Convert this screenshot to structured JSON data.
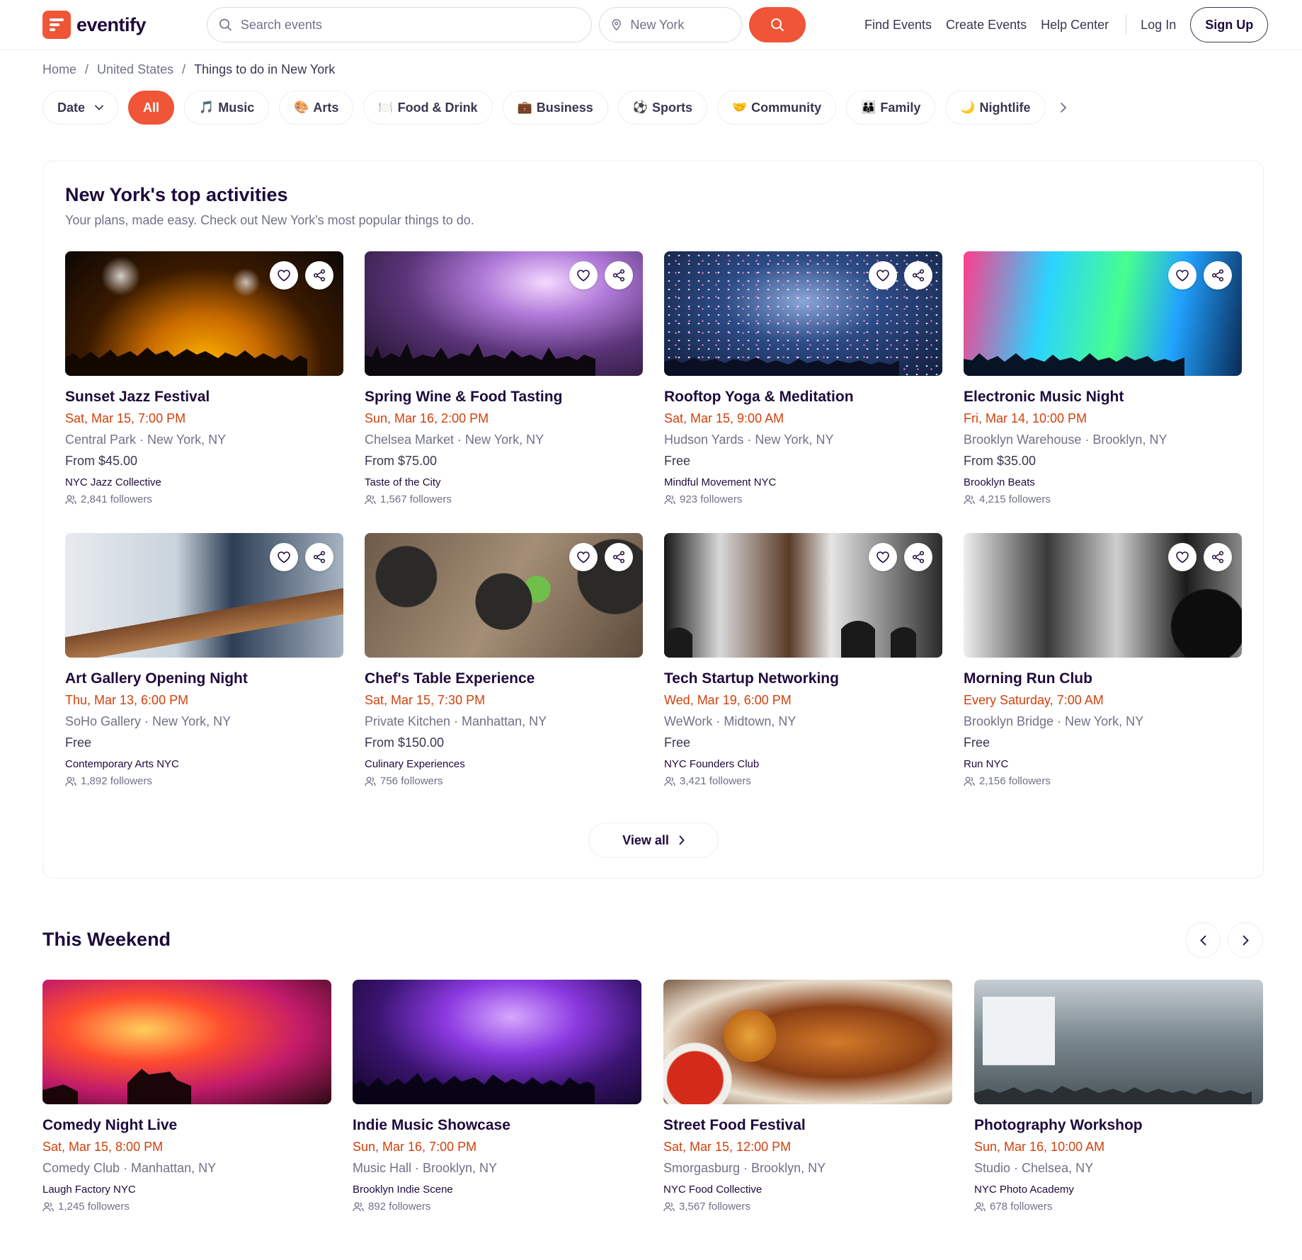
{
  "brand": {
    "name": "eventify",
    "accent": "#f05537"
  },
  "search": {
    "placeholder": "Search events",
    "location_placeholder": "New York"
  },
  "nav": {
    "find": "Find Events",
    "create": "Create Events",
    "help": "Help Center",
    "login": "Log In",
    "signup": "Sign Up"
  },
  "breadcrumb": [
    "Home",
    "United States",
    "Things to do in New York"
  ],
  "filters": {
    "date": "Date",
    "chips": [
      {
        "label": "All",
        "icon": "",
        "active": true
      },
      {
        "label": "Music",
        "icon": "🎵"
      },
      {
        "label": "Arts",
        "icon": "🎨"
      },
      {
        "label": "Food & Drink",
        "icon": "🍽️"
      },
      {
        "label": "Business",
        "icon": "💼"
      },
      {
        "label": "Sports",
        "icon": "⚽"
      },
      {
        "label": "Community",
        "icon": "🤝"
      },
      {
        "label": "Family",
        "icon": "👪"
      },
      {
        "label": "Nightlife",
        "icon": "🌙"
      }
    ]
  },
  "top": {
    "title": "New York's top activities",
    "subtitle": "Your plans, made easy. Check out New York's most popular things to do.",
    "view_all": "View all",
    "events": [
      {
        "title": "Sunset Jazz Festival",
        "date": "Sat, Mar 15, 7:00 PM",
        "location": "Central Park · New York, NY",
        "price": "From $45.00",
        "organizer": "NYC Jazz Collective",
        "followers": "2,841 followers"
      },
      {
        "title": "Spring Wine & Food Tasting",
        "date": "Sun, Mar 16, 2:00 PM",
        "location": "Chelsea Market · New York, NY",
        "price": "From $75.00",
        "organizer": "Taste of the City",
        "followers": "1,567 followers"
      },
      {
        "title": "Rooftop Yoga & Meditation",
        "date": "Sat, Mar 15, 9:00 AM",
        "location": "Hudson Yards · New York, NY",
        "price": "Free",
        "organizer": "Mindful Movement NYC",
        "followers": "923 followers"
      },
      {
        "title": "Electronic Music Night",
        "date": "Fri, Mar 14, 10:00 PM",
        "location": "Brooklyn Warehouse · Brooklyn, NY",
        "price": "From $35.00",
        "organizer": "Brooklyn Beats",
        "followers": "4,215 followers"
      },
      {
        "title": "Art Gallery Opening Night",
        "date": "Thu, Mar 13, 6:00 PM",
        "location": "SoHo Gallery · New York, NY",
        "price": "Free",
        "organizer": "Contemporary Arts NYC",
        "followers": "1,892 followers"
      },
      {
        "title": "Chef's Table Experience",
        "date": "Sat, Mar 15, 7:30 PM",
        "location": "Private Kitchen · Manhattan, NY",
        "price": "From $150.00",
        "organizer": "Culinary Experiences",
        "followers": "756 followers"
      },
      {
        "title": "Tech Startup Networking",
        "date": "Wed, Mar 19, 6:00 PM",
        "location": "WeWork · Midtown, NY",
        "price": "Free",
        "organizer": "NYC Founders Club",
        "followers": "3,421 followers"
      },
      {
        "title": "Morning Run Club",
        "date": "Every Saturday, 7:00 AM",
        "location": "Brooklyn Bridge · New York, NY",
        "price": "Free",
        "organizer": "Run NYC",
        "followers": "2,156 followers"
      }
    ]
  },
  "weekend": {
    "title": "This Weekend",
    "events": [
      {
        "title": "Comedy Night Live",
        "date": "Sat, Mar 15, 8:00 PM",
        "location": "Comedy Club · Manhattan, NY",
        "organizer": "Laugh Factory NYC",
        "followers": "1,245 followers"
      },
      {
        "title": "Indie Music Showcase",
        "date": "Sun, Mar 16, 7:00 PM",
        "location": "Music Hall · Brooklyn, NY",
        "organizer": "Brooklyn Indie Scene",
        "followers": "892 followers"
      },
      {
        "title": "Street Food Festival",
        "date": "Sat, Mar 15, 12:00 PM",
        "location": "Smorgasburg · Brooklyn, NY",
        "organizer": "NYC Food Collective",
        "followers": "3,567 followers"
      },
      {
        "title": "Photography Workshop",
        "date": "Sun, Mar 16, 10:00 AM",
        "location": "Studio · Chelsea, NY",
        "organizer": "NYC Photo Academy",
        "followers": "678 followers"
      }
    ]
  }
}
